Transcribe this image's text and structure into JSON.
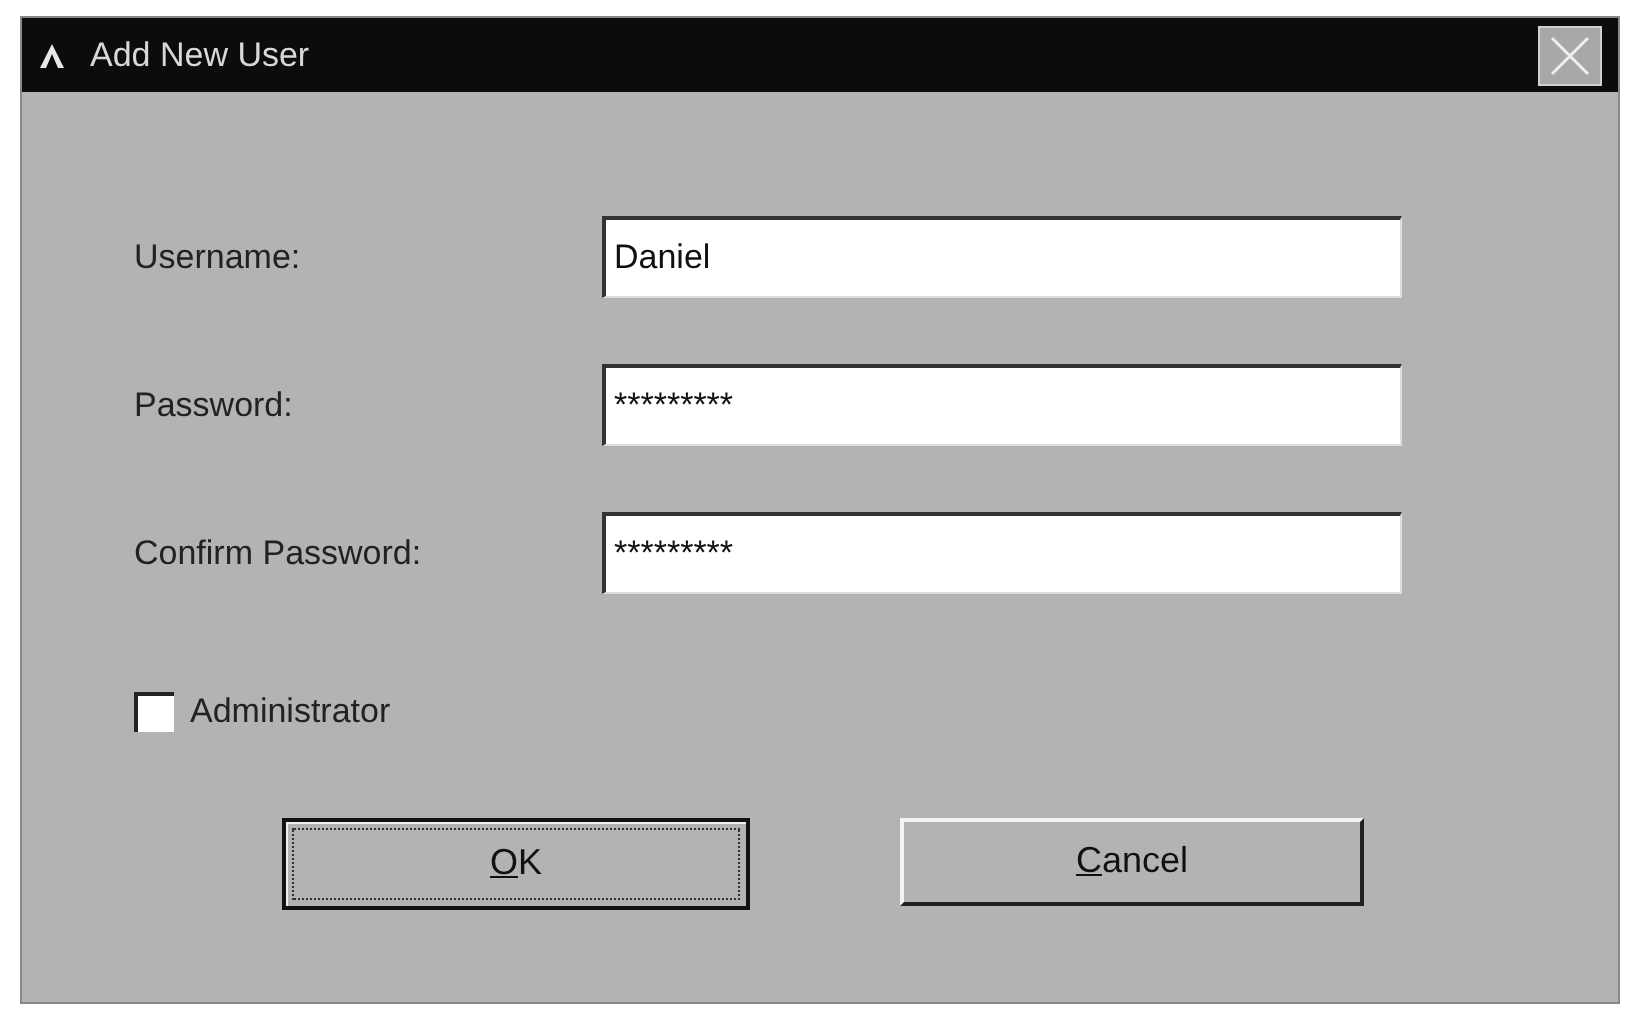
{
  "window": {
    "title": "Add New User"
  },
  "fields": [
    {
      "label": "Username:",
      "value": "Daniel"
    },
    {
      "label": "Password:",
      "value": "*********"
    },
    {
      "label": "Confirm Password:",
      "value": "*********"
    }
  ],
  "checkbox": {
    "label": "Administrator",
    "checked": false
  },
  "buttons": [
    {
      "access_key": "O",
      "label_rest": "K",
      "default": true
    },
    {
      "access_key": "C",
      "label_rest": "ancel",
      "default": false
    }
  ]
}
